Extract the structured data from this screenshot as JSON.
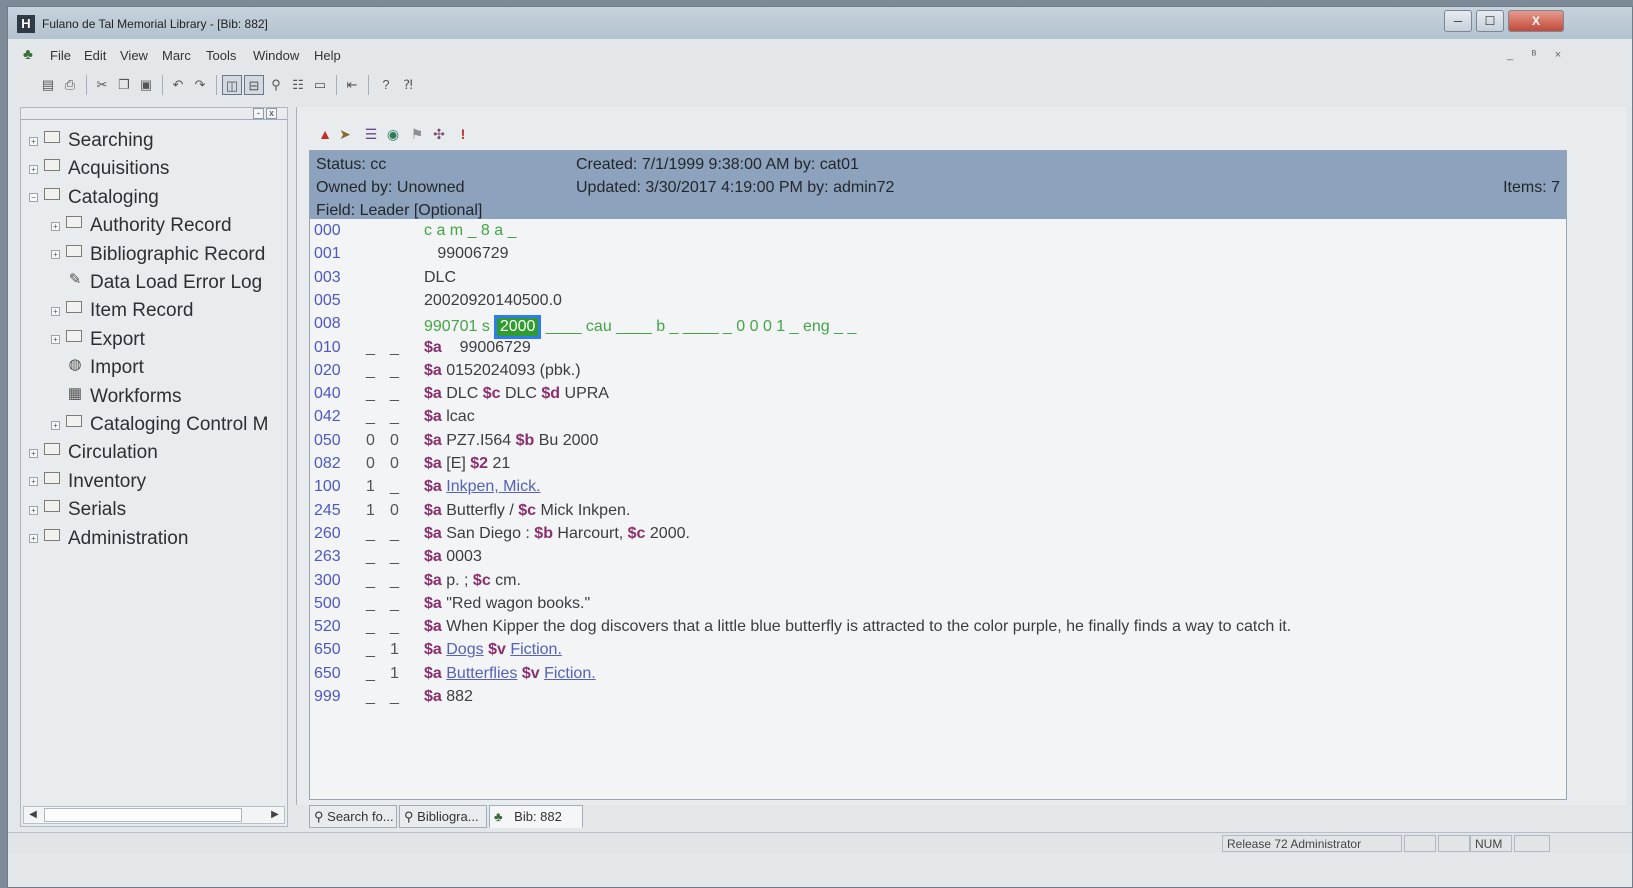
{
  "window": {
    "title": "Fulano de Tal Memorial Library - [Bib: 882]",
    "app_icon": "H",
    "controls": [
      "minimize-icon",
      "maximize-icon",
      "close-icon"
    ],
    "control_glyphs": [
      "─",
      "☐",
      "X"
    ]
  },
  "menu": {
    "items": [
      "File",
      "Edit",
      "View",
      "Marc",
      "Tools",
      "Window",
      "Help"
    ],
    "mdi_glyphs": [
      "_",
      "ᴮ",
      "×"
    ]
  },
  "toolbar": {
    "icons": [
      "save-icon",
      "print-icon",
      "cut-icon",
      "copy-icon",
      "paste-icon",
      "undo-icon",
      "redo-icon",
      "tile-icon",
      "cascade-icon",
      "search-icon",
      "records-icon",
      "form-icon",
      "import-icon",
      "help-icon",
      "context-help-icon"
    ]
  },
  "nav_tree": {
    "header_buttons": [
      "-",
      "x"
    ],
    "items": [
      {
        "label": "Searching",
        "level": 0,
        "expander": "+",
        "icon": "folder-icon"
      },
      {
        "label": "Acquisitions",
        "level": 0,
        "expander": "+",
        "icon": "folder-icon"
      },
      {
        "label": "Cataloging",
        "level": 0,
        "expander": "−",
        "icon": "open-folder-icon"
      },
      {
        "label": "Authority Record",
        "level": 1,
        "expander": "+",
        "icon": "folder-icon"
      },
      {
        "label": "Bibliographic Record",
        "level": 1,
        "expander": "+",
        "icon": "folder-icon"
      },
      {
        "label": "Data Load Error Log",
        "level": 1,
        "expander": "",
        "icon": "error-log-icon"
      },
      {
        "label": "Item Record",
        "level": 1,
        "expander": "+",
        "icon": "folder-icon"
      },
      {
        "label": "Export",
        "level": 1,
        "expander": "+",
        "icon": "folder-icon"
      },
      {
        "label": "Import",
        "level": 1,
        "expander": "",
        "icon": "import-icon"
      },
      {
        "label": "Workforms",
        "level": 1,
        "expander": "",
        "icon": "workform-icon"
      },
      {
        "label": "Cataloging Control M",
        "level": 1,
        "expander": "+",
        "icon": "folder-icon"
      },
      {
        "label": "Circulation",
        "level": 0,
        "expander": "+",
        "icon": "folder-icon"
      },
      {
        "label": "Inventory",
        "level": 0,
        "expander": "+",
        "icon": "folder-icon"
      },
      {
        "label": "Serials",
        "level": 0,
        "expander": "+",
        "icon": "folder-icon"
      },
      {
        "label": "Administration",
        "level": 0,
        "expander": "+",
        "icon": "folder-icon"
      }
    ]
  },
  "record": {
    "toolbar_icons": [
      "warning-icon",
      "validate-icon",
      "list-icon",
      "link-icon",
      "bookmark-icon",
      "authority-icon",
      "alert-icon"
    ],
    "status": "Status: cc",
    "owned_by": "Owned by: Unowned",
    "field": "Field: Leader [Optional]",
    "created": "Created: 7/1/1999 9:38:00 AM by: cat01",
    "updated": "Updated: 3/30/2017 4:19:00 PM by: admin72",
    "items": "Items: 7",
    "fields": [
      {
        "tag": "000",
        "ind1": "",
        "ind2": "",
        "segments": [
          {
            "t": "c a m _ 8 a _",
            "s": "green"
          }
        ]
      },
      {
        "tag": "001",
        "ind1": "",
        "ind2": "",
        "segments": [
          {
            "t": "   99006729",
            "s": "plain"
          }
        ]
      },
      {
        "tag": "003",
        "ind1": "",
        "ind2": "",
        "segments": [
          {
            "t": "DLC",
            "s": "plain"
          }
        ]
      },
      {
        "tag": "005",
        "ind1": "",
        "ind2": "",
        "segments": [
          {
            "t": "20020920140500.0",
            "s": "plain"
          }
        ]
      },
      {
        "tag": "008",
        "ind1": "",
        "ind2": "",
        "segments": [
          {
            "t": "990701 s",
            "s": "green"
          },
          {
            "t": "2000",
            "s": "hl"
          },
          {
            "t": " ____ cau ____ b _ ____ _ 0 0 0 1 _ eng _ _",
            "s": "green"
          }
        ]
      },
      {
        "tag": "010",
        "ind1": "_",
        "ind2": "_",
        "segments": [
          {
            "t": "$a",
            "s": "sf"
          },
          {
            "t": "    99006729",
            "s": "plain"
          }
        ]
      },
      {
        "tag": "020",
        "ind1": "_",
        "ind2": "_",
        "segments": [
          {
            "t": "$a",
            "s": "sf"
          },
          {
            "t": " 0152024093 (pbk.)",
            "s": "plain"
          }
        ]
      },
      {
        "tag": "040",
        "ind1": "_",
        "ind2": "_",
        "segments": [
          {
            "t": "$a",
            "s": "sf"
          },
          {
            "t": " DLC ",
            "s": "plain"
          },
          {
            "t": "$c",
            "s": "sf"
          },
          {
            "t": " DLC ",
            "s": "plain"
          },
          {
            "t": "$d",
            "s": "sf"
          },
          {
            "t": " UPRA",
            "s": "plain"
          }
        ]
      },
      {
        "tag": "042",
        "ind1": "_",
        "ind2": "_",
        "segments": [
          {
            "t": "$a",
            "s": "sf"
          },
          {
            "t": " lcac",
            "s": "plain"
          }
        ]
      },
      {
        "tag": "050",
        "ind1": "0",
        "ind2": "0",
        "segments": [
          {
            "t": "$a",
            "s": "sf"
          },
          {
            "t": " PZ7.I564 ",
            "s": "plain"
          },
          {
            "t": "$b",
            "s": "sf"
          },
          {
            "t": " Bu 2000",
            "s": "plain"
          }
        ]
      },
      {
        "tag": "082",
        "ind1": "0",
        "ind2": "0",
        "segments": [
          {
            "t": "$a",
            "s": "sf"
          },
          {
            "t": " [E] ",
            "s": "plain"
          },
          {
            "t": "$2",
            "s": "sf"
          },
          {
            "t": " 21",
            "s": "plain"
          }
        ]
      },
      {
        "tag": "100",
        "ind1": "1",
        "ind2": "_",
        "segments": [
          {
            "t": "$a",
            "s": "sf"
          },
          {
            "t": " ",
            "s": "plain"
          },
          {
            "t": "Inkpen, Mick.",
            "s": "link"
          }
        ]
      },
      {
        "tag": "245",
        "ind1": "1",
        "ind2": "0",
        "segments": [
          {
            "t": "$a",
            "s": "sf"
          },
          {
            "t": " Butterfly / ",
            "s": "plain"
          },
          {
            "t": "$c",
            "s": "sf"
          },
          {
            "t": " Mick Inkpen.",
            "s": "plain"
          }
        ]
      },
      {
        "tag": "260",
        "ind1": "_",
        "ind2": "_",
        "segments": [
          {
            "t": "$a",
            "s": "sf"
          },
          {
            "t": " San Diego : ",
            "s": "plain"
          },
          {
            "t": "$b",
            "s": "sf"
          },
          {
            "t": " Harcourt, ",
            "s": "plain"
          },
          {
            "t": "$c",
            "s": "sf"
          },
          {
            "t": " 2000.",
            "s": "plain"
          }
        ]
      },
      {
        "tag": "263",
        "ind1": "_",
        "ind2": "_",
        "segments": [
          {
            "t": "$a",
            "s": "sf"
          },
          {
            "t": " 0003",
            "s": "plain"
          }
        ]
      },
      {
        "tag": "300",
        "ind1": "_",
        "ind2": "_",
        "segments": [
          {
            "t": "$a",
            "s": "sf"
          },
          {
            "t": " p. ; ",
            "s": "plain"
          },
          {
            "t": "$c",
            "s": "sf"
          },
          {
            "t": " cm.",
            "s": "plain"
          }
        ]
      },
      {
        "tag": "500",
        "ind1": "_",
        "ind2": "_",
        "segments": [
          {
            "t": "$a",
            "s": "sf"
          },
          {
            "t": " \"Red wagon books.\"",
            "s": "plain"
          }
        ]
      },
      {
        "tag": "520",
        "ind1": "_",
        "ind2": "_",
        "segments": [
          {
            "t": "$a",
            "s": "sf"
          },
          {
            "t": " When Kipper the dog discovers that a little blue butterfly is attracted to the color purple, he finally finds a way to catch it.",
            "s": "plain"
          }
        ]
      },
      {
        "tag": "650",
        "ind1": "_",
        "ind2": "1",
        "segments": [
          {
            "t": "$a",
            "s": "sf"
          },
          {
            "t": " ",
            "s": "plain"
          },
          {
            "t": "Dogs",
            "s": "link"
          },
          {
            "t": " ",
            "s": "plain"
          },
          {
            "t": "$v",
            "s": "sf"
          },
          {
            "t": " ",
            "s": "plain"
          },
          {
            "t": "Fiction.",
            "s": "link"
          }
        ]
      },
      {
        "tag": "650",
        "ind1": "_",
        "ind2": "1",
        "segments": [
          {
            "t": "$a",
            "s": "sf"
          },
          {
            "t": " ",
            "s": "plain"
          },
          {
            "t": "Butterflies",
            "s": "link"
          },
          {
            "t": " ",
            "s": "plain"
          },
          {
            "t": "$v",
            "s": "sf"
          },
          {
            "t": " ",
            "s": "plain"
          },
          {
            "t": "Fiction.",
            "s": "link"
          }
        ]
      },
      {
        "tag": "999",
        "ind1": "_",
        "ind2": "_",
        "segments": [
          {
            "t": "$a",
            "s": "sf"
          },
          {
            "t": " 882",
            "s": "plain"
          }
        ]
      }
    ]
  },
  "tabs": [
    {
      "label": "Search fo...",
      "icon": "search-icon"
    },
    {
      "label": "Bibliogra...",
      "icon": "search-icon"
    },
    {
      "label": "Bib: 882",
      "icon": "record-icon"
    }
  ],
  "status_bar": {
    "panels": [
      "Release 72 Administrator",
      "",
      "",
      "NUM",
      ""
    ]
  },
  "colors": {
    "info_band": "#8da2bd",
    "tag": "#4f58c0",
    "subfield": "#8b2f6c",
    "fixed_field": "#45a545",
    "highlight_border": "#2f7bf0"
  }
}
